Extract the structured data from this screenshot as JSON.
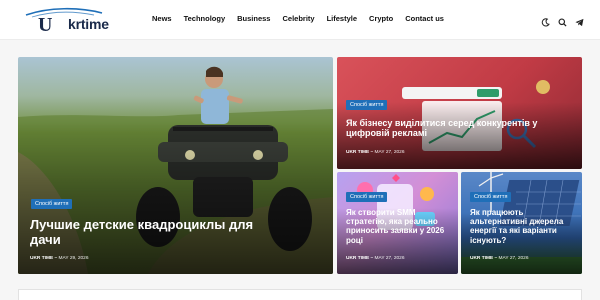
{
  "site": {
    "logo_text": "krtime",
    "logo_letter": "U"
  },
  "nav": {
    "items": [
      {
        "label": "News"
      },
      {
        "label": "Technology"
      },
      {
        "label": "Business"
      },
      {
        "label": "Celebrity"
      },
      {
        "label": "Lifestyle"
      },
      {
        "label": "Crypto"
      },
      {
        "label": "Contact us"
      }
    ]
  },
  "header_icons": [
    "moon-icon",
    "search-icon",
    "telegram-icon"
  ],
  "articles": [
    {
      "badge": "Спосіб життя",
      "title": "Лучшие детские квадроциклы для дачи",
      "author": "UKR TIME",
      "date": "MAY 29, 2026"
    },
    {
      "badge": "Спосіб життя",
      "title": "Як бізнесу виділитися серед конкурентів у цифровій рекламі",
      "author": "UKR TIME",
      "date": "MAY 27, 2026"
    },
    {
      "badge": "Спосіб життя",
      "title": "Як створити SMM стратегію, яка реально приносить заявки у 2026 році",
      "author": "UKR TIME",
      "date": "MAY 27, 2026"
    },
    {
      "badge": "Спосіб життя",
      "title": "Як працюють альтернативні джерела енергії та які варіанти існують?",
      "author": "UKR TIME",
      "date": "MAY 27, 2026"
    }
  ],
  "colors": {
    "badge": "#1f6fb8",
    "logo": "#1a2a4a",
    "header_bg": "#ffffff"
  }
}
